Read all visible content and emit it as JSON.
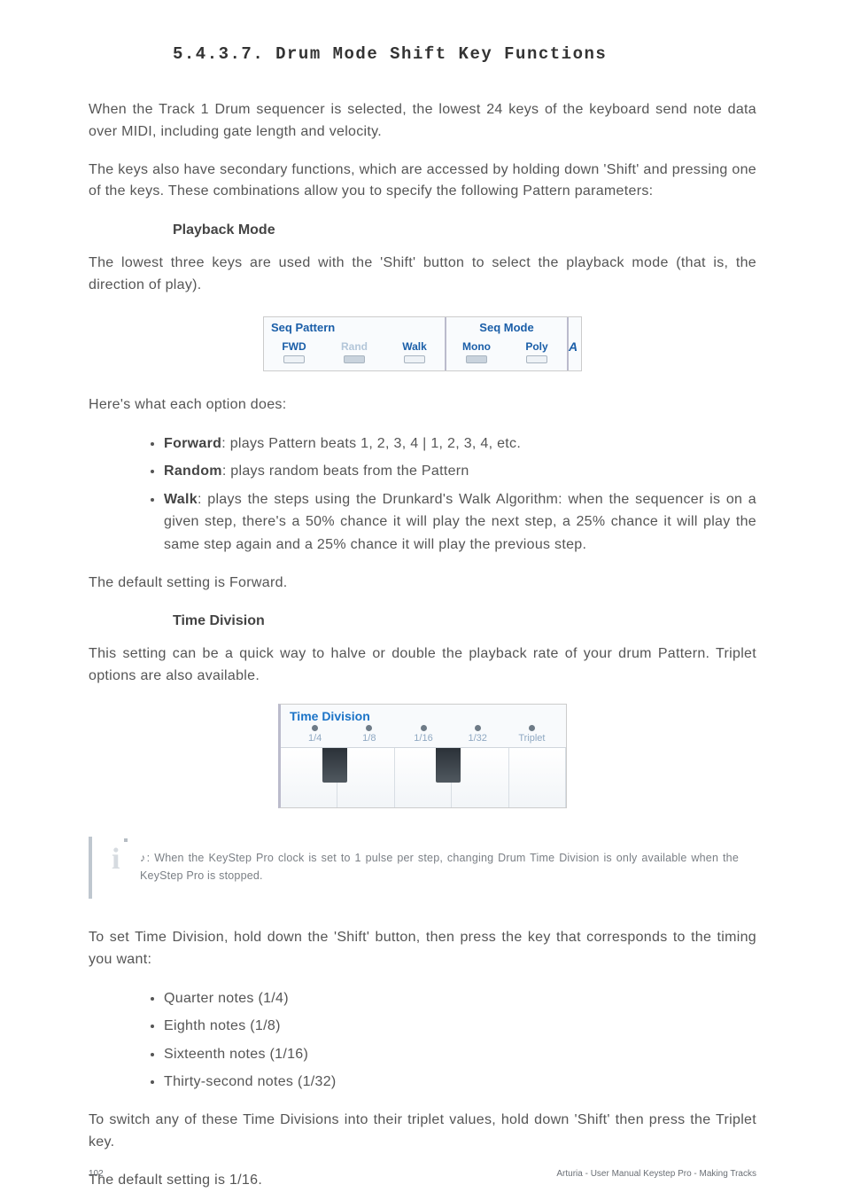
{
  "heading": "5.4.3.7. Drum Mode Shift Key Functions",
  "paragraphs": {
    "intro1": "When the Track 1 Drum sequencer is selected, the lowest 24 keys of the keyboard send note data over MIDI, including gate length and velocity.",
    "intro2": "The keys also have secondary functions, which are accessed by holding down 'Shift' and pressing one of the keys. These combinations allow you to specify the following Pattern parameters:",
    "playback_heading": "Playback Mode",
    "playback_body": "The lowest three keys are used with the 'Shift' button to select the playback mode (that is, the direction of play).",
    "options_intro": "Here's what each option does:",
    "forward_lbl": "Forward",
    "forward_txt": ": plays Pattern beats 1, 2, 3, 4 | 1, 2, 3, 4, etc.",
    "random_lbl": "Random",
    "random_txt": ": plays random beats from the Pattern",
    "walk_lbl": "Walk",
    "walk_txt": ": plays the steps using the Drunkard's Walk Algorithm: when the sequencer is on a given step, there's a 50% chance it will play the next step, a 25% chance it will play the same step again and a 25% chance it will play the previous step.",
    "default1": "The default setting is Forward.",
    "td_heading": "Time Division",
    "td_body": "This setting can be a quick way to halve or double the playback rate of your drum Pattern. Triplet options are also available.",
    "note": "♪: When the KeyStep Pro clock is set to 1 pulse per step, changing Drum Time Division is only available when the KeyStep Pro is stopped.",
    "td_set": "To set Time Division, hold down the 'Shift' button, then press the key that corresponds to the timing you want:",
    "td_opt1": "Quarter notes (1/4)",
    "td_opt2": "Eighth notes (1/8)",
    "td_opt3": "Sixteenth notes (1/16)",
    "td_opt4": "Thirty-second notes (1/32)",
    "triplet": "To switch any of these Time Divisions into their triplet values, hold down 'Shift' then press the Triplet key.",
    "default2": "The default setting is 1/16."
  },
  "fig1": {
    "seq_pattern": "Seq Pattern",
    "seq_mode": "Seq Mode",
    "fwd": "FWD",
    "rand": "Rand",
    "walk": "Walk",
    "mono": "Mono",
    "poly": "Poly",
    "arp": "A"
  },
  "fig2": {
    "title": "Time Division",
    "l1": "1/4",
    "l2": "1/8",
    "l3": "1/16",
    "l4": "1/32",
    "l5": "Triplet"
  },
  "footer": {
    "page": "102",
    "right": "Arturia - User Manual Keystep Pro - Making Tracks"
  }
}
